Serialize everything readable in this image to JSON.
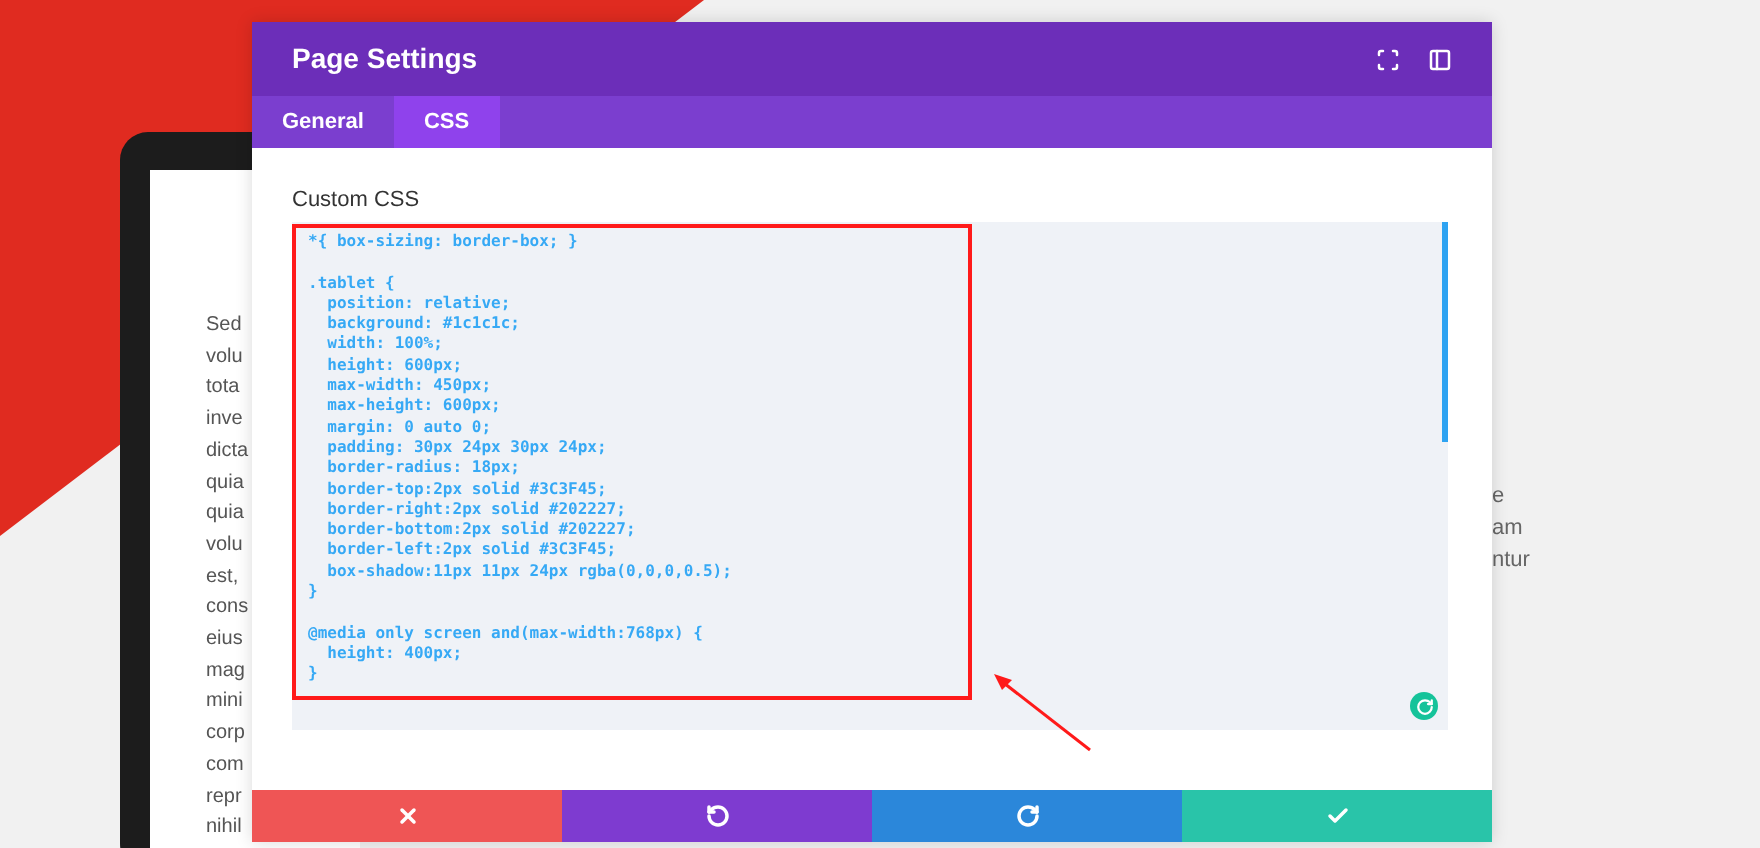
{
  "background_page": {
    "left_text_lines": [
      "Sed",
      "volu",
      "tota",
      "inve",
      "dicta",
      "quia",
      "quia",
      "volu",
      "est,",
      "cons",
      "eius",
      "mag",
      "mini",
      "corp",
      "com",
      "repr",
      "nihil"
    ],
    "right_text_lines": [
      "e",
      "am",
      "ntur"
    ]
  },
  "window": {
    "title": "Page Settings"
  },
  "tabs": [
    {
      "label": "General",
      "selected": false
    },
    {
      "label": "CSS",
      "selected": true
    }
  ],
  "custom_css": {
    "label": "Custom CSS",
    "value": "*{ box-sizing: border-box; }\n\n.tablet {\n  position: relative;\n  background: #1c1c1c;\n  width: 100%;\n  height: 600px;\n  max-width: 450px;\n  max-height: 600px;\n  margin: 0 auto 0;\n  padding: 30px 24px 30px 24px;\n  border-radius: 18px;\n  border-top:2px solid #3C3F45;\n  border-right:2px solid #202227;\n  border-bottom:2px solid #202227;\n  border-left:2px solid #3C3F45;\n  box-shadow:11px 11px 24px rgba(0,0,0,0.5);\n}\n\n@media only screen and(max-width:768px) {\n  height: 400px;\n}"
  },
  "footer_buttons": [
    {
      "kind": "discard"
    },
    {
      "kind": "undo"
    },
    {
      "kind": "redo"
    },
    {
      "kind": "save"
    }
  ]
}
